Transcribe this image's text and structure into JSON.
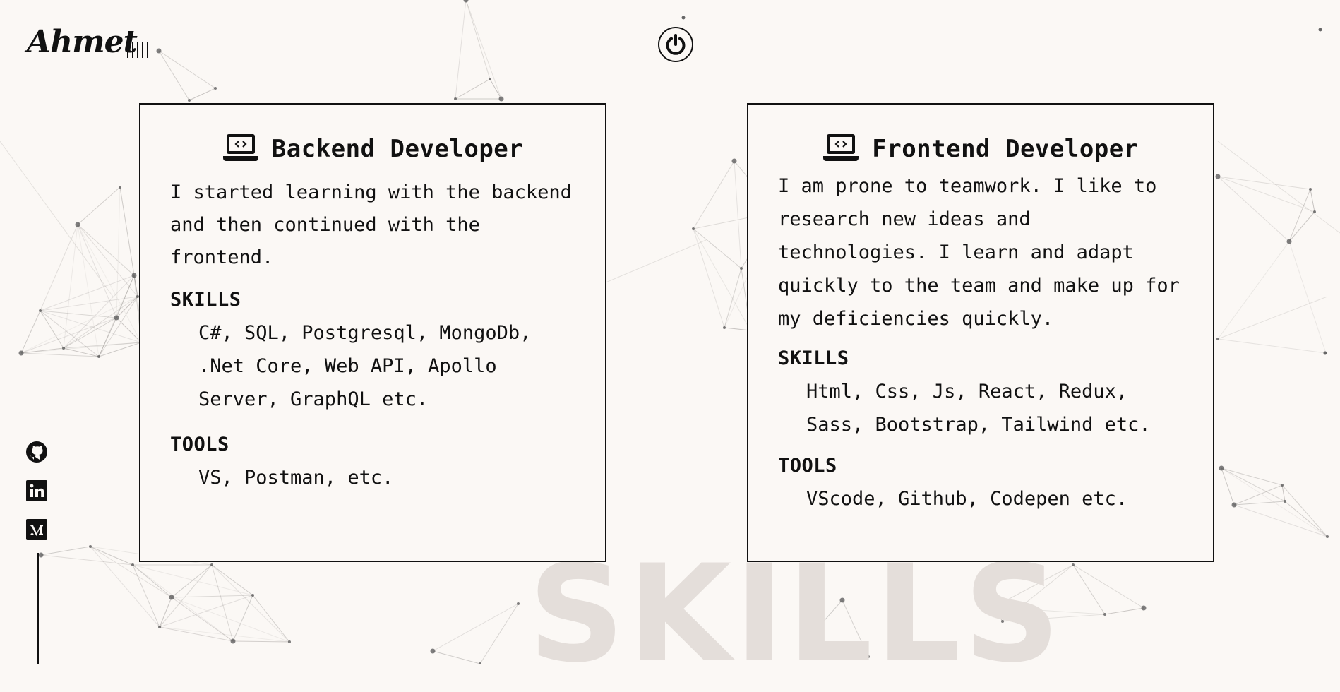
{
  "header": {
    "logo": "Ahmet"
  },
  "icons": {
    "menu": "menu-bars-icon",
    "power": "power-icon",
    "laptop": "laptop-code-icon",
    "github": "github-icon",
    "linkedin": "linkedin-icon",
    "medium": "medium-icon"
  },
  "cards": [
    {
      "title": "Backend Developer",
      "description": "I started learning with the backend and then continued with the frontend.",
      "skills_label": "SKILLS",
      "skills": "C#, SQL, Postgresql, MongoDb, .Net Core, Web API, Apollo Server, GraphQL etc.",
      "tools_label": "TOOLS",
      "tools": "VS, Postman, etc."
    },
    {
      "title": "Frontend Developer",
      "description": "I am prone to teamwork. I like to research new ideas and technologies. I learn and adapt quickly to the team and make up for my deficiencies quickly.",
      "skills_label": "SKILLS",
      "skills": "Html, Css, Js, React, Redux, Sass, Bootstrap, Tailwind etc.",
      "tools_label": "TOOLS",
      "tools": "VScode, Github, Codepen etc."
    }
  ],
  "watermark": "SKILLS",
  "colors": {
    "background": "#fbf8f5",
    "ink": "#111111",
    "watermark": "#e4deda",
    "network": "#8a8683"
  }
}
